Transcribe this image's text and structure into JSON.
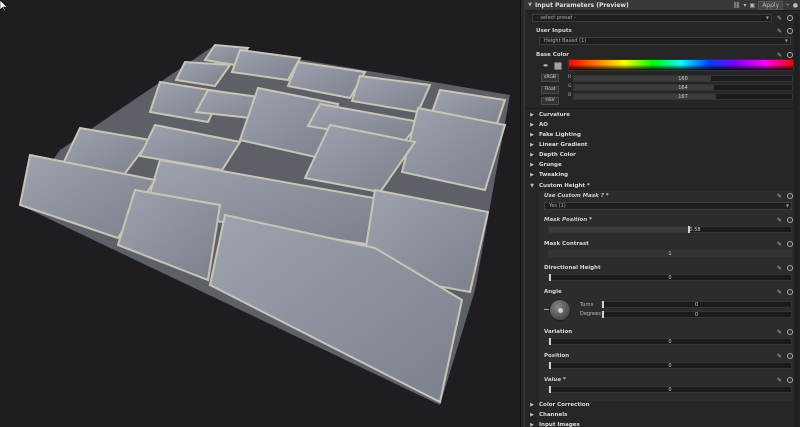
{
  "panel": {
    "title": "Input Parameters (Preview)",
    "apply_label": "Apply",
    "preset_placeholder": "- select preset -"
  },
  "user_inputs": {
    "label": "User Inputs",
    "mode_value": "Height Based (1)"
  },
  "base_color": {
    "label": "Base Color",
    "srgb": "sRGB",
    "float": "Float",
    "hsv": "HSV",
    "r_label": "R",
    "g_label": "G",
    "b_label": "B",
    "r": "160",
    "g": "164",
    "b": "167",
    "r_frac": 0.63,
    "g_frac": 0.64,
    "b_frac": 0.65,
    "swatch_color": "#a0a4a7"
  },
  "categories": [
    "Curvature",
    "AO",
    "Fake Lighting",
    "Linear Gradient",
    "Depth Color",
    "Grunge",
    "Tweaking"
  ],
  "custom_height": {
    "label": "Custom Height *",
    "use_mask_label": "Use Custom Mask ? *",
    "use_mask_value": "Yes (1)",
    "mask_position_label": "Mask Position *",
    "mask_position_value": "0.58",
    "mask_position_frac": 0.58,
    "mask_contrast_label": "Mask Contrast",
    "mask_contrast_value": "1",
    "mask_contrast_frac": 1.0,
    "directional_height_label": "Directional Height",
    "directional_height_value": "0",
    "angle_label": "Angle",
    "turns_label": "Turns",
    "turns_value": "0",
    "degrees_label": "Degrees",
    "degrees_value": "0",
    "variation_label": "Variation",
    "variation_value": "0",
    "position_label": "Position",
    "position_value": "0",
    "value_label": "Value *",
    "value_value": "0"
  },
  "bottom_categories": [
    "Color Correction",
    "Channels",
    "Input Images"
  ]
}
